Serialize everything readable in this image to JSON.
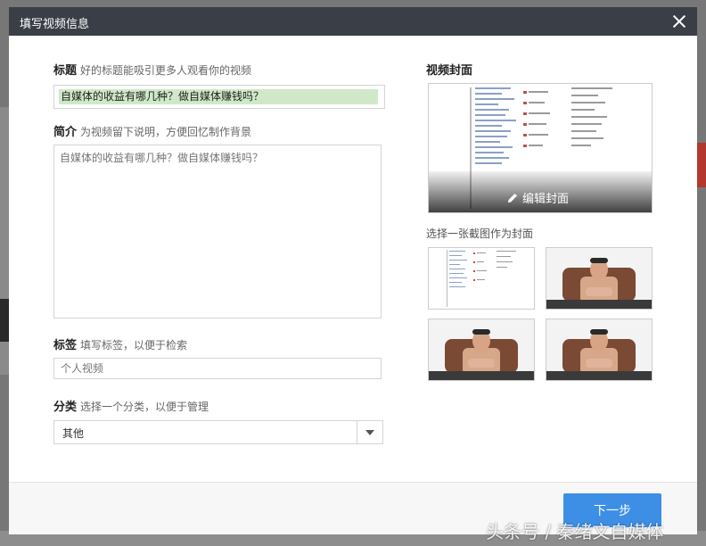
{
  "dialog": {
    "title": "填写视频信息",
    "close_icon": "close-icon"
  },
  "form": {
    "title_label": "标题",
    "title_hint": "好的标题能吸引更多人观看你的视频",
    "title_value": "自媒体的收益有哪几种？做自媒体赚钱吗？",
    "desc_label": "简介",
    "desc_hint": "为视频留下说明，方便回忆制作背景",
    "desc_placeholder": "自媒体的收益有哪几种？做自媒体赚钱吗？",
    "tags_label": "标签",
    "tags_hint": "填写标签，以便于检索",
    "tags_placeholder": "个人视频",
    "category_label": "分类",
    "category_hint": "选择一个分类，以便于管理",
    "category_value": "其他"
  },
  "cover": {
    "title": "视频封面",
    "edit_label": "编辑封面",
    "edit_icon": "pencil-icon",
    "pick_title": "选择一张截图作为封面"
  },
  "footer": {
    "next_label": "下一步"
  },
  "watermark": "头条号 / 秦绪文自媒体",
  "colors": {
    "header_bg": "#3a3f47",
    "title_highlight": "#cfe9c8",
    "primary_button": "#3d8fe6"
  }
}
